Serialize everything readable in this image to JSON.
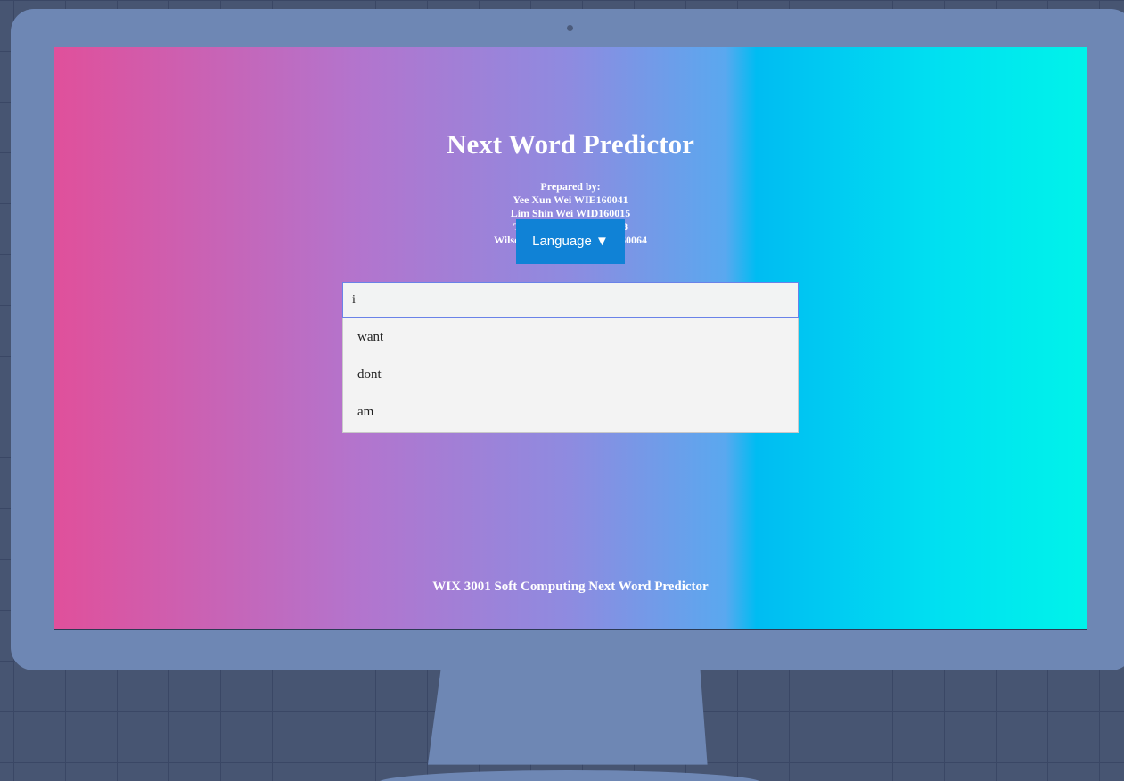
{
  "app": {
    "title": "Next Word Predictor"
  },
  "credits": {
    "heading": "Prepared by:",
    "authors": [
      "Yee Xun Wei WIE160041",
      "Lim Shin Wei WID160015",
      "Tan Lay Yan WIF160058",
      "Wilson Tan Wei Hian WIF160064"
    ]
  },
  "language_button": {
    "label": "Language ▼"
  },
  "search": {
    "value": "i",
    "placeholder": ""
  },
  "suggestions": [
    "want",
    "dont",
    "am"
  ],
  "footer": {
    "text": "WIX 3001 Soft Computing Next Word Predictor"
  },
  "colors": {
    "background": "#475572",
    "monitor": "#6e87b4",
    "button": "#1082d6",
    "gradient_start": "#e0509b",
    "gradient_end": "#00f3ea"
  },
  "icons": {
    "dropdown": "triangle-down-icon",
    "camera": "camera-dot-icon"
  }
}
